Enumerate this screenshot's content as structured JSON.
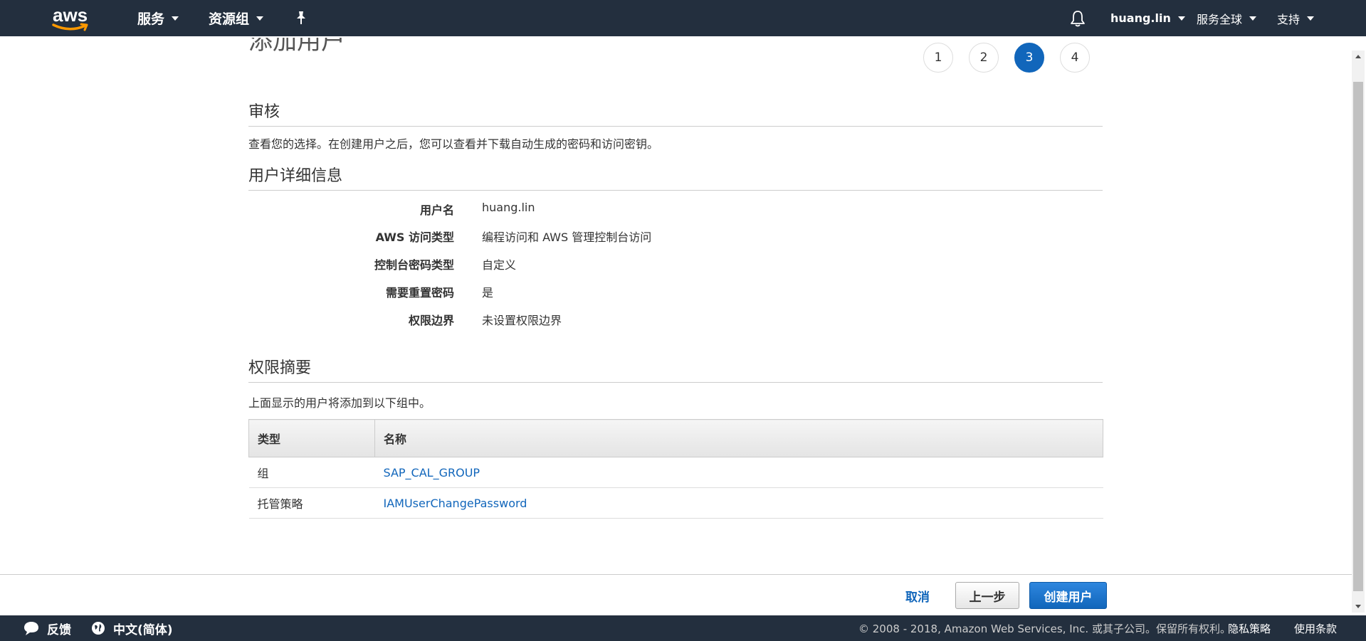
{
  "nav": {
    "logo_text": "aws",
    "services": "服务",
    "resource_groups": "资源组",
    "username": "huang.lin",
    "region": "服务全球",
    "support": "支持"
  },
  "wizard": {
    "title": "添加用户",
    "steps": [
      "1",
      "2",
      "3",
      "4"
    ],
    "active_step": "3"
  },
  "review": {
    "heading": "审核",
    "description": "查看您的选择。在创建用户之后，您可以查看并下载自动生成的密码和访问密钥。"
  },
  "user_details": {
    "heading": "用户详细信息",
    "rows": [
      {
        "label": "用户名",
        "value": "huang.lin"
      },
      {
        "label": "AWS 访问类型",
        "value": "编程访问和 AWS 管理控制台访问"
      },
      {
        "label": "控制台密码类型",
        "value": "自定义"
      },
      {
        "label": "需要重置密码",
        "value": "是"
      },
      {
        "label": "权限边界",
        "value": "未设置权限边界"
      }
    ]
  },
  "permissions": {
    "heading": "权限摘要",
    "description": "上面显示的用户将添加到以下组中。",
    "columns": [
      "类型",
      "名称"
    ],
    "rows": [
      {
        "type": "组",
        "name": "SAP_CAL_GROUP"
      },
      {
        "type": "托管策略",
        "name": "IAMUserChangePassword"
      }
    ]
  },
  "actions": {
    "cancel": "取消",
    "previous": "上一步",
    "create": "创建用户"
  },
  "footer": {
    "feedback": "反馈",
    "language": "中文(简体)",
    "copyright": "© 2008 - 2018, Amazon Web Services, Inc. 或其子公司。保留所有权利。",
    "privacy": "隐私策略",
    "terms": "使用条款"
  },
  "colors": {
    "nav_bg": "#232f3e",
    "accent": "#1166bb",
    "aws_smile": "#ff9900"
  }
}
